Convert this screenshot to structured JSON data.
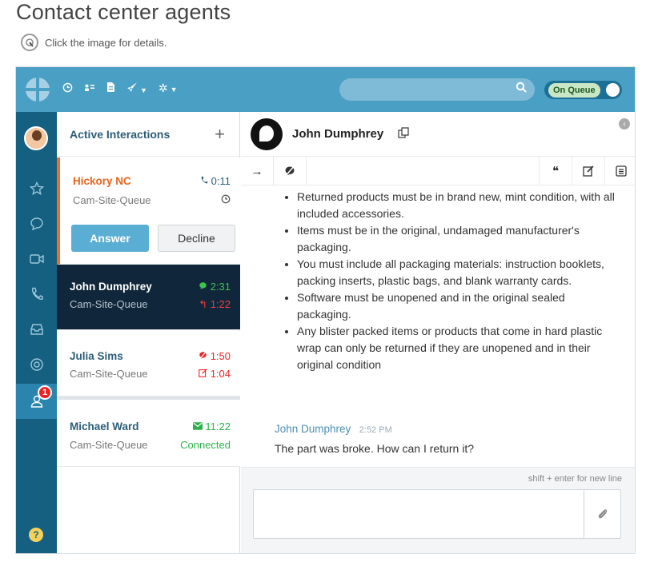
{
  "page": {
    "title": "Contact center agents",
    "hint": "Click the image for details."
  },
  "topbar": {
    "queue_label": "On Queue",
    "icons": [
      "logo-icon",
      "clock-icon",
      "contacts-icon",
      "document-icon",
      "rocket-icon",
      "gear-icon",
      "search-icon"
    ]
  },
  "leftnav": {
    "badge": "1",
    "help": "?"
  },
  "panel": {
    "title": "Active Interactions",
    "add": "+",
    "interactions": [
      {
        "name": "Hickory NC",
        "queue": "Cam-Site-Queue",
        "meta1": "0:11",
        "meta1_icon": "phone-icon",
        "meta2_icon": "clock-icon",
        "answer": "Answer",
        "decline": "Decline"
      },
      {
        "name": "John Dumphrey",
        "queue": "Cam-Site-Queue",
        "meta1": "2:31",
        "meta1_icon": "chat-icon",
        "meta2": "1:22",
        "meta2_icon": "reply-icon"
      },
      {
        "name": "Julia Sims",
        "queue": "Cam-Site-Queue",
        "meta1": "1:50",
        "meta1_icon": "chat-off-icon",
        "meta2": "1:04",
        "meta2_icon": "edit-icon"
      },
      {
        "name": "Michael Ward",
        "queue": "Cam-Site-Queue",
        "meta1": "11:22",
        "meta1_icon": "email-icon",
        "meta2": "Connected"
      }
    ]
  },
  "convo": {
    "contact_name": "John Dumphrey",
    "rules": [
      "Returned products must be in brand new, mint condition, with all included accessories.",
      "Items must be in the original, undamaged manufacturer's packaging.",
      "You must include all packaging materials: instruction booklets, packing inserts, plastic bags, and blank warranty cards.",
      "Software must be unopened and in the original sealed packaging.",
      "Any blister packed items or products that come in hard plastic wrap can only be returned if they are unopened and in their original condition"
    ],
    "message": {
      "author": "John Dumphrey",
      "time": "2:52 PM",
      "text": "The part was broke. How can I return it?"
    },
    "composer_hint": "shift + enter for new line"
  },
  "colors": {
    "topbar": "#4a9fc4",
    "nav": "#155f80",
    "accent_orange": "#f26d1e",
    "active_card": "#10263a",
    "green": "#2bb34a",
    "red": "#e22"
  }
}
